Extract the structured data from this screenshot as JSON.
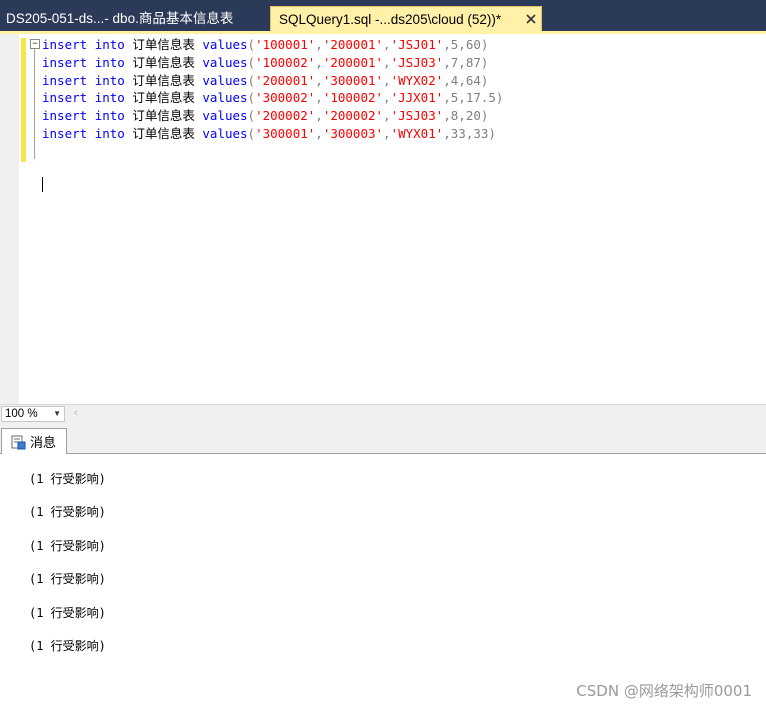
{
  "tabs": {
    "inactive_title": "DS205-051-ds...- dbo.商品基本信息表",
    "active_title": "SQLQuery1.sql -...ds205\\cloud (52))*",
    "close_icon": "close-icon"
  },
  "editor": {
    "keyword_insert": "insert",
    "keyword_into": "into",
    "table_name": "订单信息表",
    "keyword_values": "values",
    "lines": [
      {
        "v1": "'100001'",
        "v2": "'200001'",
        "v3": "'JSJ01'",
        "tail": ",5,60)"
      },
      {
        "v1": "'100002'",
        "v2": "'200001'",
        "v3": "'JSJ03'",
        "tail": ",7,87)"
      },
      {
        "v1": "'200001'",
        "v2": "'300001'",
        "v3": "'WYX02'",
        "tail": ",4,64)"
      },
      {
        "v1": "'300002'",
        "v2": "'100002'",
        "v3": "'JJX01'",
        "tail": ",5,17.5)"
      },
      {
        "v1": "'200002'",
        "v2": "'200002'",
        "v3": "'JSJ03'",
        "tail": ",8,20)"
      },
      {
        "v1": "'300001'",
        "v2": "'300003'",
        "v3": "'WYX01'",
        "tail": ",33,33)"
      }
    ]
  },
  "status": {
    "zoom": "100 %"
  },
  "results": {
    "tab_label": "消息",
    "messages": [
      "(1 行受影响)",
      "(1 行受影响)",
      "(1 行受影响)",
      "(1 行受影响)",
      "(1 行受影响)",
      "(1 行受影响)"
    ]
  },
  "watermark": "CSDN @网络架构师0001",
  "colors": {
    "keyword": "#0000ff",
    "string": "#ff0000",
    "tab_bar": "#2b3a58",
    "active_tab": "#fff1a8"
  }
}
